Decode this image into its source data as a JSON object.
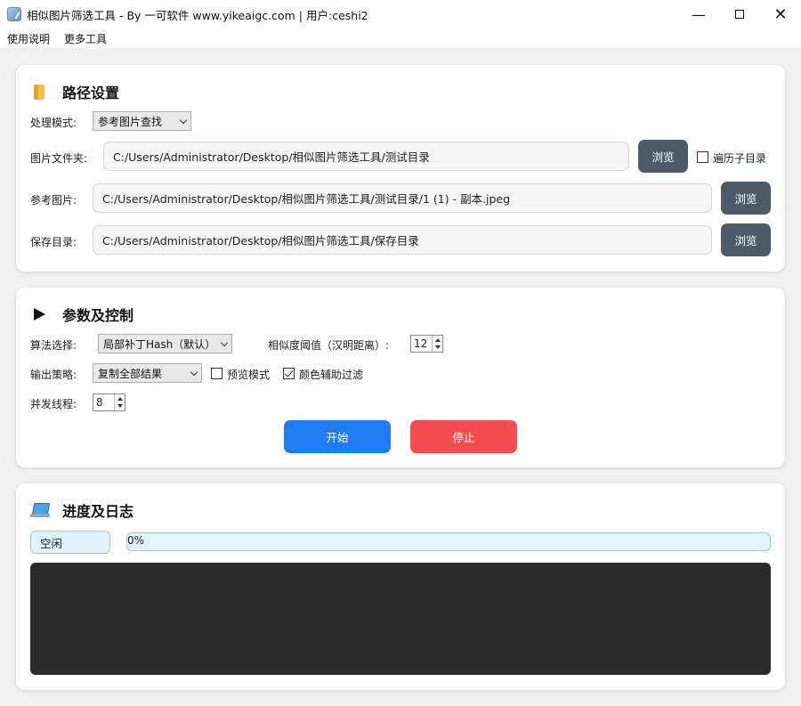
{
  "window": {
    "title": "相似图片筛选工具 - By 一可软件 www.yikeaigc.com | 用户:ceshi2",
    "icons": {
      "app": "app-icon",
      "minimize": "minimize-icon",
      "maximize": "maximize-icon",
      "close": "close-icon"
    }
  },
  "menu": {
    "items": [
      "使用说明",
      "更多工具"
    ]
  },
  "path_settings": {
    "title": "路径设置",
    "mode_label": "处理模式:",
    "mode_value": "参考图片查找",
    "folder_label": "图片文件夹:",
    "folder_value": "C:/Users/Administrator/Desktop/相似图片筛选工具/测试目录",
    "folder_browse": "浏览",
    "recursive_label": "遍历子目录",
    "recursive_checked": false,
    "ref_label": "参考图片:",
    "ref_value": "C:/Users/Administrator/Desktop/相似图片筛选工具/测试目录/1 (1) - 副本.jpeg",
    "ref_browse": "浏览",
    "save_label": "保存目录:",
    "save_value": "C:/Users/Administrator/Desktop/相似图片筛选工具/保存目录",
    "save_browse": "浏览"
  },
  "params": {
    "title": "参数及控制",
    "algo_label": "算法选择:",
    "algo_value": "局部补丁Hash（默认）",
    "threshold_label": "相似度阈值（汉明距离）:",
    "threshold_value": "12",
    "output_label": "输出策略:",
    "output_value": "复制全部结果",
    "preview_label": "预览模式",
    "preview_checked": false,
    "color_filter_label": "颜色辅助过滤",
    "color_filter_checked": true,
    "threads_label": "并发线程:",
    "threads_value": "8",
    "start_label": "开始",
    "stop_label": "停止",
    "colors": {
      "start": "#1f7cf2",
      "stop": "#f24e52"
    }
  },
  "progress": {
    "title": "进度及日志",
    "status": "空闲",
    "percent_text": "0%",
    "percent": 0
  }
}
